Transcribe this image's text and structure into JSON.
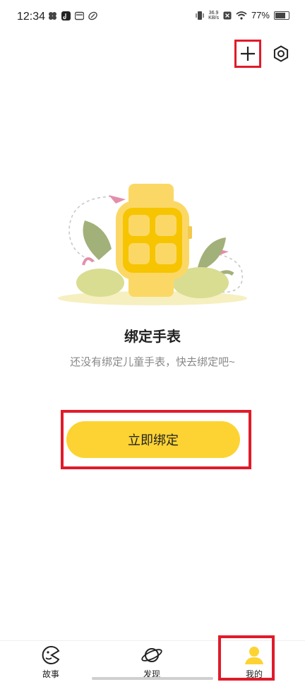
{
  "status_bar": {
    "time": "12:34",
    "net_speed_top": "36.9",
    "net_speed_bottom": "KB/s",
    "battery_percent": "77%",
    "battery_level": 0.77
  },
  "header": {
    "add_icon": "plus-icon",
    "settings_icon": "gear-icon"
  },
  "empty_state": {
    "title": "绑定手表",
    "subtitle": "还没有绑定儿童手表，快去绑定吧~",
    "button_label": "立即绑定"
  },
  "bottom_nav": {
    "items": [
      {
        "label": "故事",
        "icon": "story-icon"
      },
      {
        "label": "发现",
        "icon": "planet-icon"
      },
      {
        "label": "我的",
        "icon": "user-icon",
        "active": true
      }
    ]
  },
  "colors": {
    "accent": "#fcd333",
    "highlight_box": "#e01b2a",
    "watch_body": "#fbd866",
    "watch_screen": "#f6c400",
    "leaf_green": "#a2b07a"
  }
}
